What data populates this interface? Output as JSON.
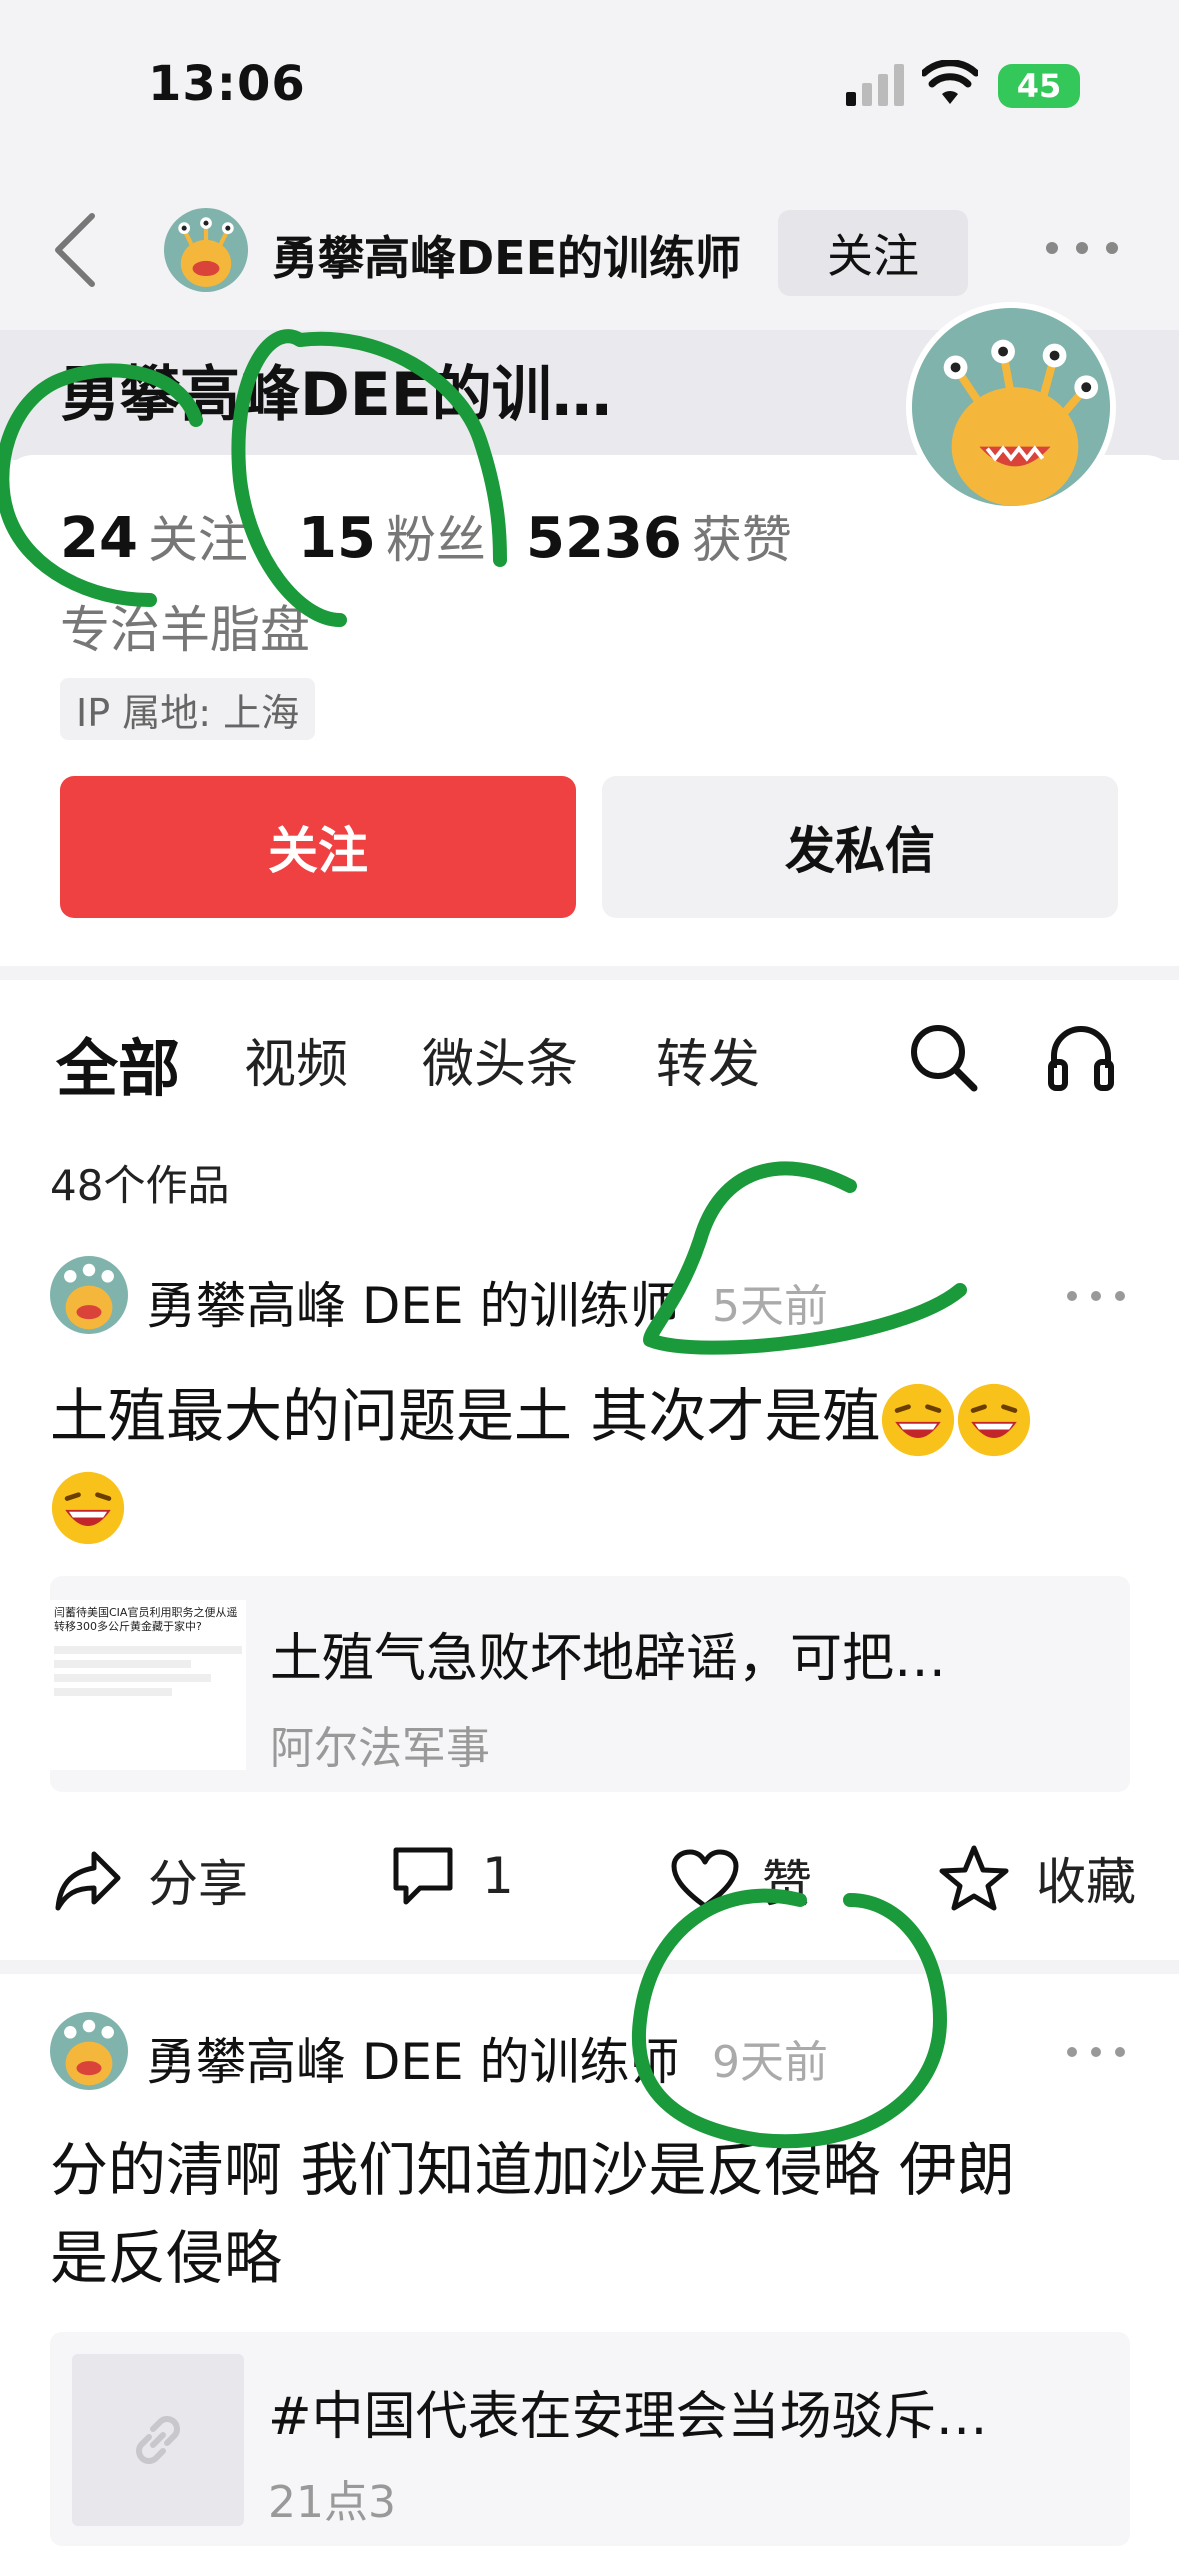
{
  "status_bar": {
    "time": "13:06",
    "battery": "45"
  },
  "nav": {
    "title": "勇攀高峰DEE的训练师",
    "follow_label": "关注"
  },
  "profile": {
    "name": "勇攀高峰DEE的训…",
    "following_count": "24",
    "following_label": "关注",
    "fans_count": "15",
    "fans_label": "粉丝",
    "likes_count": "5236",
    "likes_label": "获赞",
    "bio": "专治羊脂盘",
    "ip": "IP 属地: 上海",
    "follow_button": "关注",
    "message_button": "发私信"
  },
  "tabs": [
    {
      "label": "全部",
      "active": true
    },
    {
      "label": "视频"
    },
    {
      "label": "微头条"
    },
    {
      "label": "转发"
    }
  ],
  "works_count": "48个作品",
  "posts": [
    {
      "author": "勇攀高峰 DEE 的训练师",
      "time": "5天前",
      "text": "土殖最大的问题是土 其次才是殖",
      "card_title": "土殖气急败坏地辟谣，可把…",
      "card_source": "阿尔法军事",
      "thumb_lines": [
        "闫蓄待美国CIA官员利用职务之便从遥",
        "转移300多公斤黄金藏于家中?"
      ],
      "actions": {
        "share": "分享",
        "comments": "1",
        "like": "赞",
        "collect": "收藏"
      }
    },
    {
      "author": "勇攀高峰 DEE 的训练师",
      "time": "9天前",
      "text_line1": "分的清啊 我们知道加沙是反侵略 伊朗",
      "text_line2": "是反侵略",
      "card_title": "#中国代表在安理会当场驳斥…",
      "card_source": "21点3"
    }
  ],
  "colors": {
    "accent_red": "#f04142",
    "marker_green": "#1a9a3a",
    "battery_green": "#34c759"
  }
}
